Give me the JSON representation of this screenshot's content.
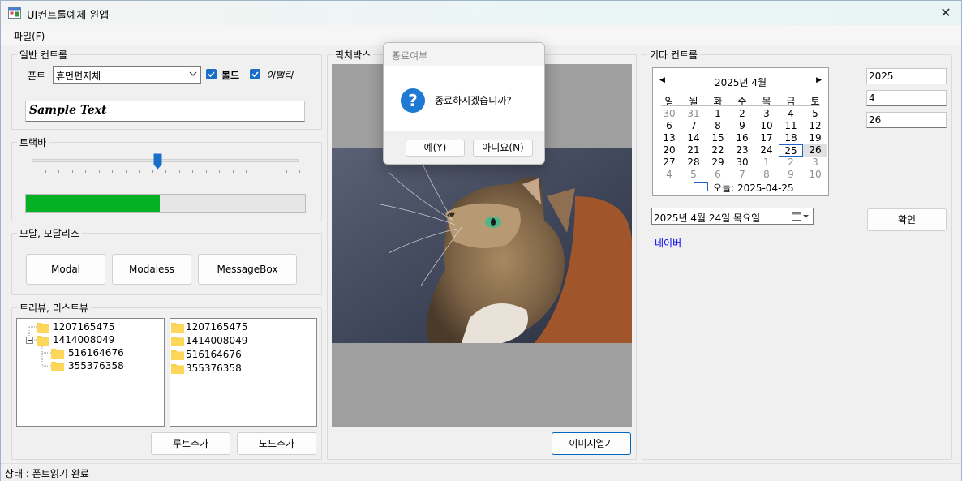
{
  "window": {
    "title": "UI컨트롤예제 윈앱",
    "close_glyph": "✕"
  },
  "menu": {
    "file": "파일(F)"
  },
  "general": {
    "legend": "일반 컨트롤",
    "font_label": "폰트",
    "font_value": "휴먼편지체",
    "bold_label": "볼드",
    "italic_label": "이탤릭",
    "bold_checked": true,
    "italic_checked": true,
    "sample_text": "Sample Text"
  },
  "trackbar": {
    "legend": "트랙바",
    "value_fraction": 0.47,
    "progress_fraction": 0.48,
    "progress_color": "#06b025"
  },
  "modal": {
    "legend": "모달, 모달리스",
    "buttons": [
      "Modal",
      "Modaless",
      "MessageBox"
    ]
  },
  "treelist": {
    "legend": "트리뷰, 리스트뷰",
    "tree": [
      {
        "text": "1207165475",
        "level": 0
      },
      {
        "text": "1414008049",
        "level": 0,
        "expanded": true
      },
      {
        "text": "516164676",
        "level": 1
      },
      {
        "text": "355376358",
        "level": 1
      }
    ],
    "list": [
      "1207165475",
      "1414008049",
      "516164676",
      "355376358"
    ],
    "add_root": "루트추가",
    "add_node": "노드추가"
  },
  "picture": {
    "legend": "픽처박스",
    "open_button": "이미지열기",
    "image_desc_icon": "cat-photo"
  },
  "other": {
    "legend": "기타 컨트롤",
    "calendar": {
      "title": "2025년 4월",
      "weekdays": [
        "일",
        "월",
        "화",
        "수",
        "목",
        "금",
        "토"
      ],
      "weeks": [
        [
          "30",
          "31",
          "1",
          "2",
          "3",
          "4",
          "5"
        ],
        [
          "6",
          "7",
          "8",
          "9",
          "10",
          "11",
          "12"
        ],
        [
          "13",
          "14",
          "15",
          "16",
          "17",
          "18",
          "19"
        ],
        [
          "20",
          "21",
          "22",
          "23",
          "24",
          "25",
          "26"
        ],
        [
          "27",
          "28",
          "29",
          "30",
          "1",
          "2",
          "3"
        ],
        [
          "4",
          "5",
          "6",
          "7",
          "8",
          "9",
          "10"
        ]
      ],
      "today_label": "오늘: 2025-04-25"
    },
    "year": "2025",
    "month": "4",
    "day": "26",
    "date_picker": "2025년   4월 24일 목요일",
    "ok_button": "확인",
    "link": "네이버",
    "link_color": "#0000ee"
  },
  "dialog": {
    "title": "종료여부",
    "message": "종료하시겠습니까?",
    "yes": "예(Y)",
    "no": "아니요(N)",
    "icon": "question-icon"
  },
  "status": "상태 : 폰트읽기 완료"
}
